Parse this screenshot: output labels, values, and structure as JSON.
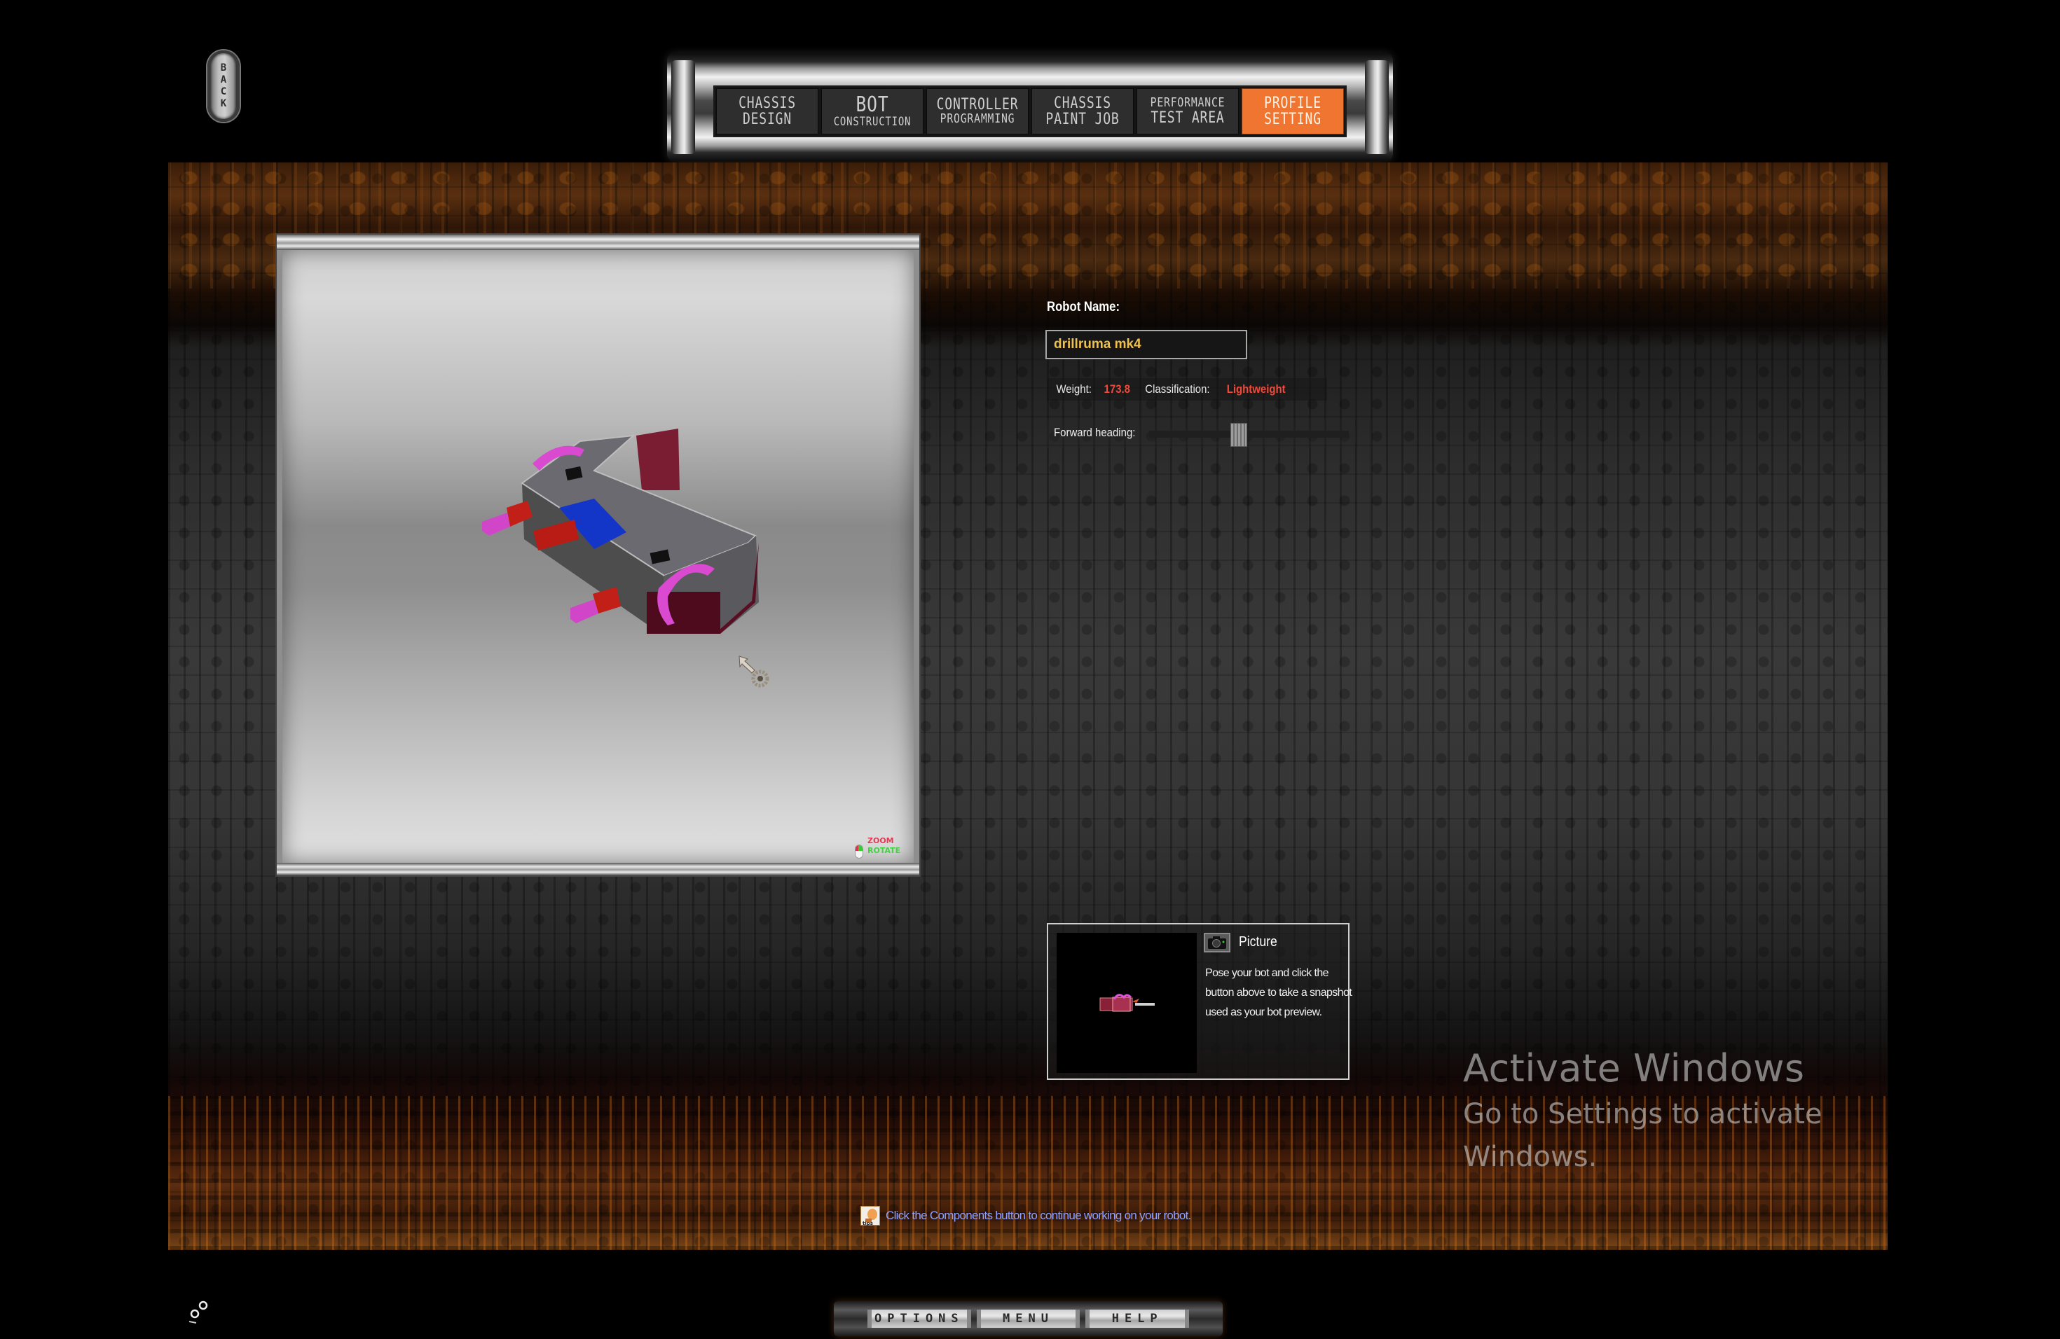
{
  "back_button": {
    "label": "BACK",
    "icon": "back-icon"
  },
  "nav": {
    "tabs": [
      {
        "line1": "CHASSIS",
        "line2": "DESIGN",
        "active": false
      },
      {
        "line1": "BOT",
        "line2": "CONSTRUCTION",
        "active": false
      },
      {
        "line1": "CONTROLLER",
        "line2": "PROGRAMMING",
        "active": false
      },
      {
        "line1": "CHASSIS",
        "line2": "PAINT JOB",
        "active": false
      },
      {
        "line1": "PERFORMANCE",
        "line2": "TEST AREA",
        "active": false
      },
      {
        "line1": "PROFILE",
        "line2": "SETTING",
        "active": true
      }
    ],
    "active_color": "#f07530"
  },
  "viewport": {
    "mouse_legend": {
      "zoom": "ZOOM",
      "rotate": "ROTATE"
    },
    "colors": {
      "zoom": "#e23a55",
      "rotate": "#3dd43d"
    },
    "cursor_icon": "gear-arrow-cursor-icon",
    "model": "robot-3d-model"
  },
  "profile": {
    "robot_name_label": "Robot Name:",
    "robot_name_value": "drillruma mk4",
    "weight_label": "Weight:",
    "weight_value": "173.8",
    "classification_label": "Classification:",
    "classification_value": "Lightweight",
    "forward_heading_label": "Forward heading:",
    "forward_heading_fraction": 0.45,
    "value_color": "#f04a3a",
    "name_color": "#f0c04c"
  },
  "picture": {
    "title": "Picture",
    "description": "Pose your bot and click the button above to take a snapshot used as your bot preview.",
    "camera_icon": "camera-icon"
  },
  "tip": {
    "icon": "tips-lightbulb-icon",
    "icon_label": "tips",
    "text": "Click the Components button to continue working on your robot.",
    "color": "#8fa0ff"
  },
  "watermark": {
    "title": "Activate Windows",
    "subtitle": "Go to Settings to activate Windows."
  },
  "bottom_menu": {
    "items": [
      "OPTIONS",
      "MENU",
      "HELP"
    ]
  }
}
